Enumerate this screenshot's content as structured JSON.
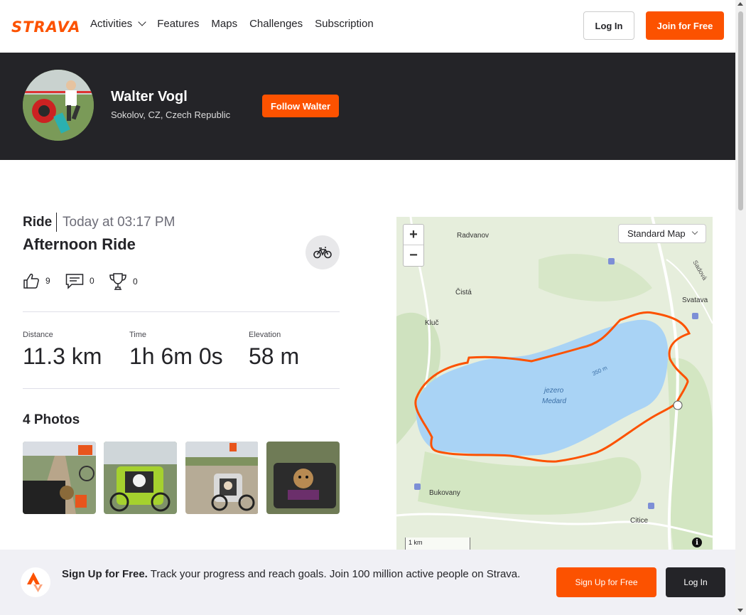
{
  "nav": {
    "logo": "STRAVA",
    "links": [
      "Activities",
      "Features",
      "Maps",
      "Challenges",
      "Subscription"
    ],
    "login": "Log In",
    "join": "Join for Free"
  },
  "athlete": {
    "name": "Walter Vogl",
    "location": "Sokolov, CZ, Czech Republic",
    "follow": "Follow Walter"
  },
  "activity": {
    "type": "Ride",
    "time": "Today at 03:17 PM",
    "title": "Afternoon Ride",
    "kudos": "9",
    "comments": "0",
    "achievements": "0",
    "stats": [
      {
        "label": "Distance",
        "value": "11.3 km"
      },
      {
        "label": "Time",
        "value": "1h 6m 0s"
      },
      {
        "label": "Elevation",
        "value": "58 m"
      }
    ],
    "photos_title": "4 Photos"
  },
  "map": {
    "style": "Standard Map",
    "labels": [
      "Radvanov",
      "Čistá",
      "Kluč",
      "Svatava",
      "Sadová",
      "jezero",
      "Medard",
      "350 m",
      "Bukovany",
      "Citice"
    ],
    "scale": "1 km",
    "colors": {
      "route": "#fc5200",
      "lake": "#a9d3f5",
      "land": "#e6eedc"
    }
  },
  "banner": {
    "headline": "Sign Up for Free.",
    "text": "Track your progress and reach goals. Join 100 million active people on Strava.",
    "signup": "Sign Up for Free",
    "login": "Log In"
  },
  "colors": {
    "brand": "#fc5200",
    "dark": "#242428"
  }
}
